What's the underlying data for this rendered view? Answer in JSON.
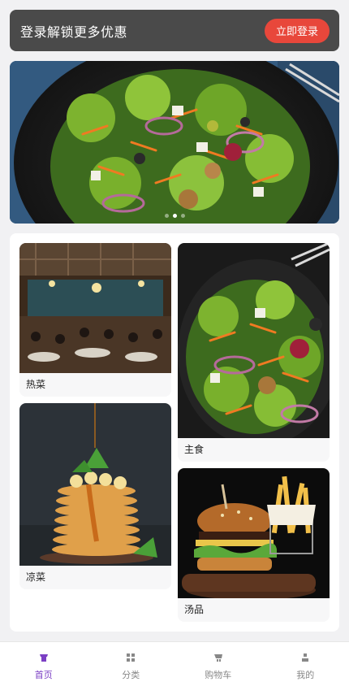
{
  "login_banner": {
    "text": "登录解锁更多优惠",
    "button": "立即登录"
  },
  "hero": {
    "slide_count": 3,
    "active_slide": 1,
    "image": "salad-plate"
  },
  "categories": [
    {
      "label": "热菜",
      "image": "restaurant-dining-hall"
    },
    {
      "label": "主食",
      "image": "salad-bowl"
    },
    {
      "label": "凉菜",
      "image": "pancake-stack"
    },
    {
      "label": "汤品",
      "image": "burger-and-fries"
    }
  ],
  "tabbar": {
    "items": [
      {
        "label": "首页",
        "icon": "home-icon",
        "active": true
      },
      {
        "label": "分类",
        "icon": "grid-icon",
        "active": false
      },
      {
        "label": "购物车",
        "icon": "cart-icon",
        "active": false
      },
      {
        "label": "我的",
        "icon": "user-icon",
        "active": false
      }
    ]
  },
  "colors": {
    "accent": "#7b3fc4",
    "login_button": "#e8473b",
    "banner_bg": "#4a4a4a"
  }
}
